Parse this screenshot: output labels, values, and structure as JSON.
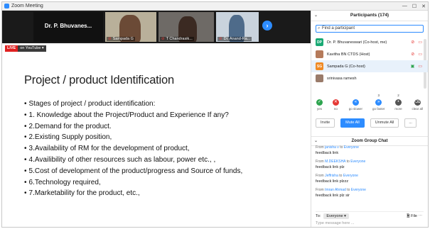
{
  "window": {
    "title": "Zoom Meeting",
    "controls": {
      "minimize": "—",
      "maximize": "☐",
      "close": "✕"
    }
  },
  "video_strip": {
    "tiles": [
      {
        "name": "Dr. P. Bhuvanes...",
        "type": "name-only"
      },
      {
        "name": "Sampada G",
        "muted": true
      },
      {
        "name": "T Chandrasik...",
        "muted": true
      },
      {
        "name": "Dr. Anand-Ra...",
        "muted": true
      }
    ],
    "next_button": "›"
  },
  "stream": {
    "live_label": "LIVE",
    "platform_label": "on YouTube ▾"
  },
  "slide": {
    "title": "Project / product Identification",
    "bullets": [
      "Stages of project / product identification:",
      "1. Knowledge about the Project/Product and Experience If any?",
      "2.Demand for the product.",
      "2.Existing Supply position,",
      "3.Availability of RM for the development of product,",
      "4.Availibility of other resources such as labour, power etc., ,",
      "5.Cost of development of the product/progress and Source of funds,",
      "6.Technology required,",
      "7.Marketability for the product, etc.,"
    ]
  },
  "participants": {
    "header": "Participants (174)",
    "search_placeholder": "Find a participant",
    "list": [
      {
        "initials": "DP",
        "name": "Dr. P. Bhuvaneswari (Co-host, me)",
        "color": "#19a974"
      },
      {
        "initials": "",
        "name": "Kavitha BN CTDS (Host)",
        "color": "#b57a5a"
      },
      {
        "initials": "SG",
        "name": "Sampada G (Co-host)",
        "color": "#f08a24"
      },
      {
        "initials": "",
        "name": "srinivasa ramesh",
        "color": "#9a7b6a"
      }
    ],
    "reactions": [
      {
        "label": "yes",
        "icon": "✓",
        "color": "#2ea44f",
        "count": ""
      },
      {
        "label": "no",
        "icon": "✕",
        "color": "#e53935",
        "count": ""
      },
      {
        "label": "go slower",
        "icon": "«",
        "color": "#2d8cff",
        "count": ""
      },
      {
        "label": "go faster",
        "icon": "»",
        "color": "#2d8cff",
        "count": "3"
      },
      {
        "label": "more",
        "icon": "•",
        "color": "#555555",
        "count": "2"
      },
      {
        "label": "clear all",
        "icon": "⌫",
        "color": "#555555",
        "count": ""
      }
    ],
    "buttons": {
      "invite": "Invite",
      "mute_all": "Mute All",
      "unmute_all": "Unmute All",
      "more": "..."
    }
  },
  "chat": {
    "header": "Zoom Group Chat",
    "messages": [
      {
        "from_label": "From",
        "sender": "janisha v",
        "to_label": "to",
        "recipient": "Everyone",
        "text": "feedback link"
      },
      {
        "from_label": "From",
        "sender": "M.DEEKSHA",
        "to_label": "to",
        "recipient": "Everyone",
        "text": "feedback link plz"
      },
      {
        "from_label": "From",
        "sender": "Jeffrisha",
        "to_label": "to",
        "recipient": "Everyone",
        "text": "feedback link plzzz"
      },
      {
        "from_label": "From",
        "sender": "Imran Ahmad",
        "to_label": "to",
        "recipient": "Everyone",
        "text": "feedback link plz sir"
      }
    ],
    "to_label": "To:",
    "to_value": "Everyone ▾",
    "file_label": "File",
    "input_placeholder": "Type message here ..."
  }
}
